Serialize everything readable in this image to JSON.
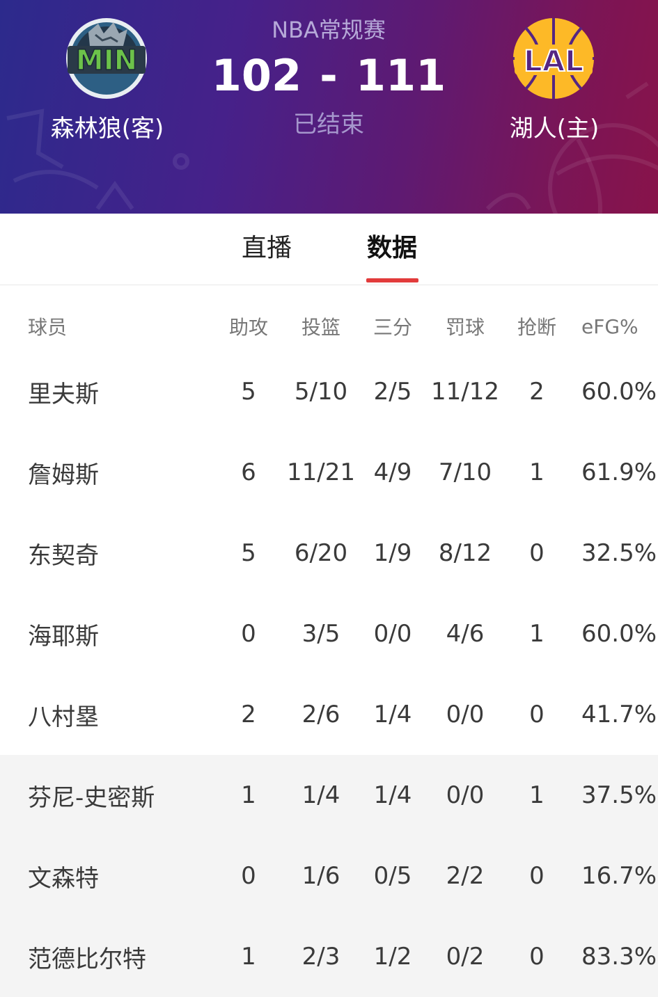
{
  "game": {
    "league": "NBA常规赛",
    "status": "已结束",
    "away": {
      "abbr": "MIN",
      "name": "森林狼(客)",
      "score": "102",
      "color": "#6cc24a"
    },
    "home": {
      "abbr": "LAL",
      "name": "湖人(主)",
      "score": "111",
      "color": "#552583",
      "accent": "#fdb927"
    },
    "separator": "-"
  },
  "tabs": [
    {
      "label": "直播",
      "active": false
    },
    {
      "label": "数据",
      "active": true
    }
  ],
  "table": {
    "columns": [
      "球员",
      "助攻",
      "投篮",
      "三分",
      "罚球",
      "抢断",
      "eFG%"
    ],
    "rows": [
      {
        "name": "里夫斯",
        "ast": "5",
        "fg": "5/10",
        "tp": "2/5",
        "ft": "11/12",
        "stl": "2",
        "efg": "60.0%",
        "bench": false
      },
      {
        "name": "詹姆斯",
        "ast": "6",
        "fg": "11/21",
        "tp": "4/9",
        "ft": "7/10",
        "stl": "1",
        "efg": "61.9%",
        "bench": false
      },
      {
        "name": "东契奇",
        "ast": "5",
        "fg": "6/20",
        "tp": "1/9",
        "ft": "8/12",
        "stl": "0",
        "efg": "32.5%",
        "bench": false
      },
      {
        "name": "海耶斯",
        "ast": "0",
        "fg": "3/5",
        "tp": "0/0",
        "ft": "4/6",
        "stl": "1",
        "efg": "60.0%",
        "bench": false
      },
      {
        "name": "八村塁",
        "ast": "2",
        "fg": "2/6",
        "tp": "1/4",
        "ft": "0/0",
        "stl": "0",
        "efg": "41.7%",
        "bench": false
      },
      {
        "name": "芬尼-史密斯",
        "ast": "1",
        "fg": "1/4",
        "tp": "1/4",
        "ft": "0/0",
        "stl": "1",
        "efg": "37.5%",
        "bench": true
      },
      {
        "name": "文森特",
        "ast": "0",
        "fg": "1/6",
        "tp": "0/5",
        "ft": "2/2",
        "stl": "0",
        "efg": "16.7%",
        "bench": true
      },
      {
        "name": "范德比尔特",
        "ast": "1",
        "fg": "2/3",
        "tp": "1/2",
        "ft": "0/2",
        "stl": "0",
        "efg": "83.3%",
        "bench": true
      }
    ]
  },
  "colors": {
    "tab_indicator": "#e23b3b",
    "bench_row_bg": "#f4f4f4"
  }
}
